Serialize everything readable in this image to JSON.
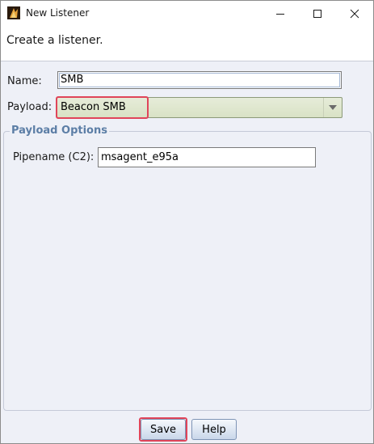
{
  "window": {
    "title": "New Listener",
    "controls": {
      "minimize_icon": "minimize-icon",
      "maximize_icon": "maximize-icon",
      "close_icon": "close-icon"
    }
  },
  "header": {
    "text": "Create a listener."
  },
  "form": {
    "name_label": "Name:",
    "name_value": "SMB",
    "payload_label": "Payload:",
    "payload_value": "Beacon SMB"
  },
  "payload_options": {
    "title": "Payload Options",
    "pipename_label": "Pipename (C2):",
    "pipename_value": "msagent_e95a"
  },
  "buttons": {
    "save": "Save",
    "help": "Help"
  },
  "colors": {
    "highlight": "#e0455a",
    "group_title": "#5c7ea6",
    "select_bg": "#d9e2c5"
  }
}
